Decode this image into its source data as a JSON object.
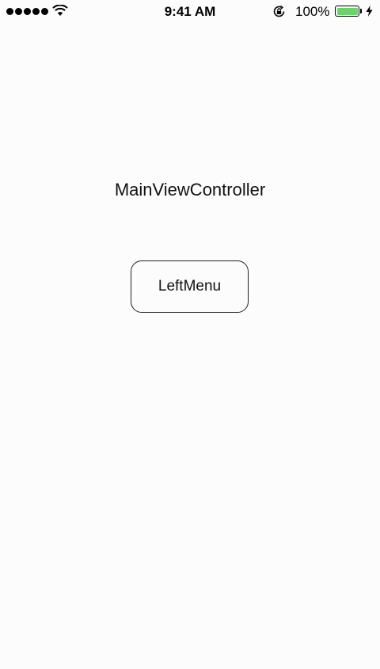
{
  "status_bar": {
    "time": "9:41 AM",
    "battery_percent": "100%",
    "signal_dots": 5,
    "battery_level": 1.0,
    "battery_color": "#6cd36a",
    "icons": [
      "signal-icon",
      "wifi-icon",
      "rotation-lock-icon",
      "battery-icon",
      "charging-bolt-icon"
    ]
  },
  "main": {
    "title": "MainViewController",
    "left_menu_label": "LeftMenu"
  }
}
